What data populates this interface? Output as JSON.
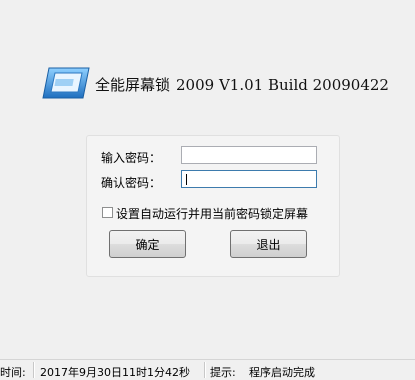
{
  "header": {
    "app_name": "全能屏幕锁",
    "version_text": "2009 V1.01 Build 20090422",
    "logo_icon": "screen-monitor-icon"
  },
  "form": {
    "password_label": "输入密码：",
    "password_value": "",
    "confirm_label": "确认密码：",
    "confirm_value": "",
    "checkbox_label": "设置自动运行并用当前密码锁定屏幕",
    "checkbox_checked": false,
    "ok_button": "确定",
    "exit_button": "退出"
  },
  "statusbar": {
    "time_label": "时间:",
    "time_value": "2017年9月30日11时1分42秒",
    "hint_label": "提示:",
    "hint_value": "程序启动完成"
  },
  "colors": {
    "background": "#f0f0f0",
    "logo_blue": "#3a8fd8",
    "focus_border": "#3d7bad"
  }
}
